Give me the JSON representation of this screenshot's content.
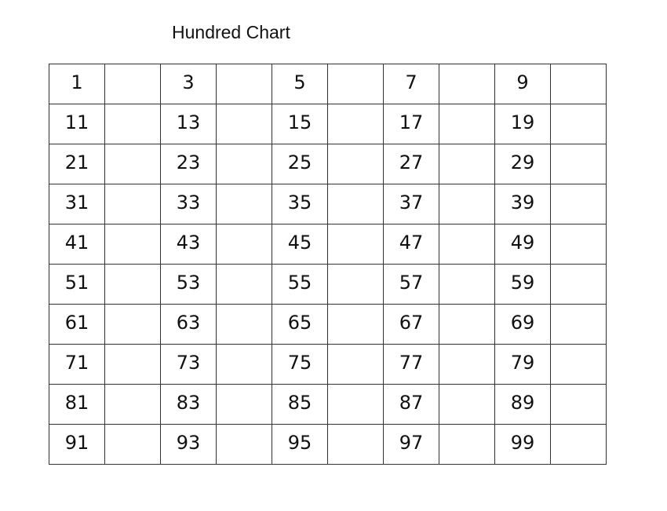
{
  "title": "Hundred Chart",
  "rows": [
    [
      "1",
      "",
      "3",
      "",
      "5",
      "",
      "7",
      "",
      "9",
      ""
    ],
    [
      "11",
      "",
      "13",
      "",
      "15",
      "",
      "17",
      "",
      "19",
      ""
    ],
    [
      "21",
      "",
      "23",
      "",
      "25",
      "",
      "27",
      "",
      "29",
      ""
    ],
    [
      "31",
      "",
      "33",
      "",
      "35",
      "",
      "37",
      "",
      "39",
      ""
    ],
    [
      "41",
      "",
      "43",
      "",
      "45",
      "",
      "47",
      "",
      "49",
      ""
    ],
    [
      "51",
      "",
      "53",
      "",
      "55",
      "",
      "57",
      "",
      "59",
      ""
    ],
    [
      "61",
      "",
      "63",
      "",
      "65",
      "",
      "67",
      "",
      "69",
      ""
    ],
    [
      "71",
      "",
      "73",
      "",
      "75",
      "",
      "77",
      "",
      "79",
      ""
    ],
    [
      "81",
      "",
      "83",
      "",
      "85",
      "",
      "87",
      "",
      "89",
      ""
    ],
    [
      "91",
      "",
      "93",
      "",
      "95",
      "",
      "97",
      "",
      "99",
      ""
    ]
  ]
}
